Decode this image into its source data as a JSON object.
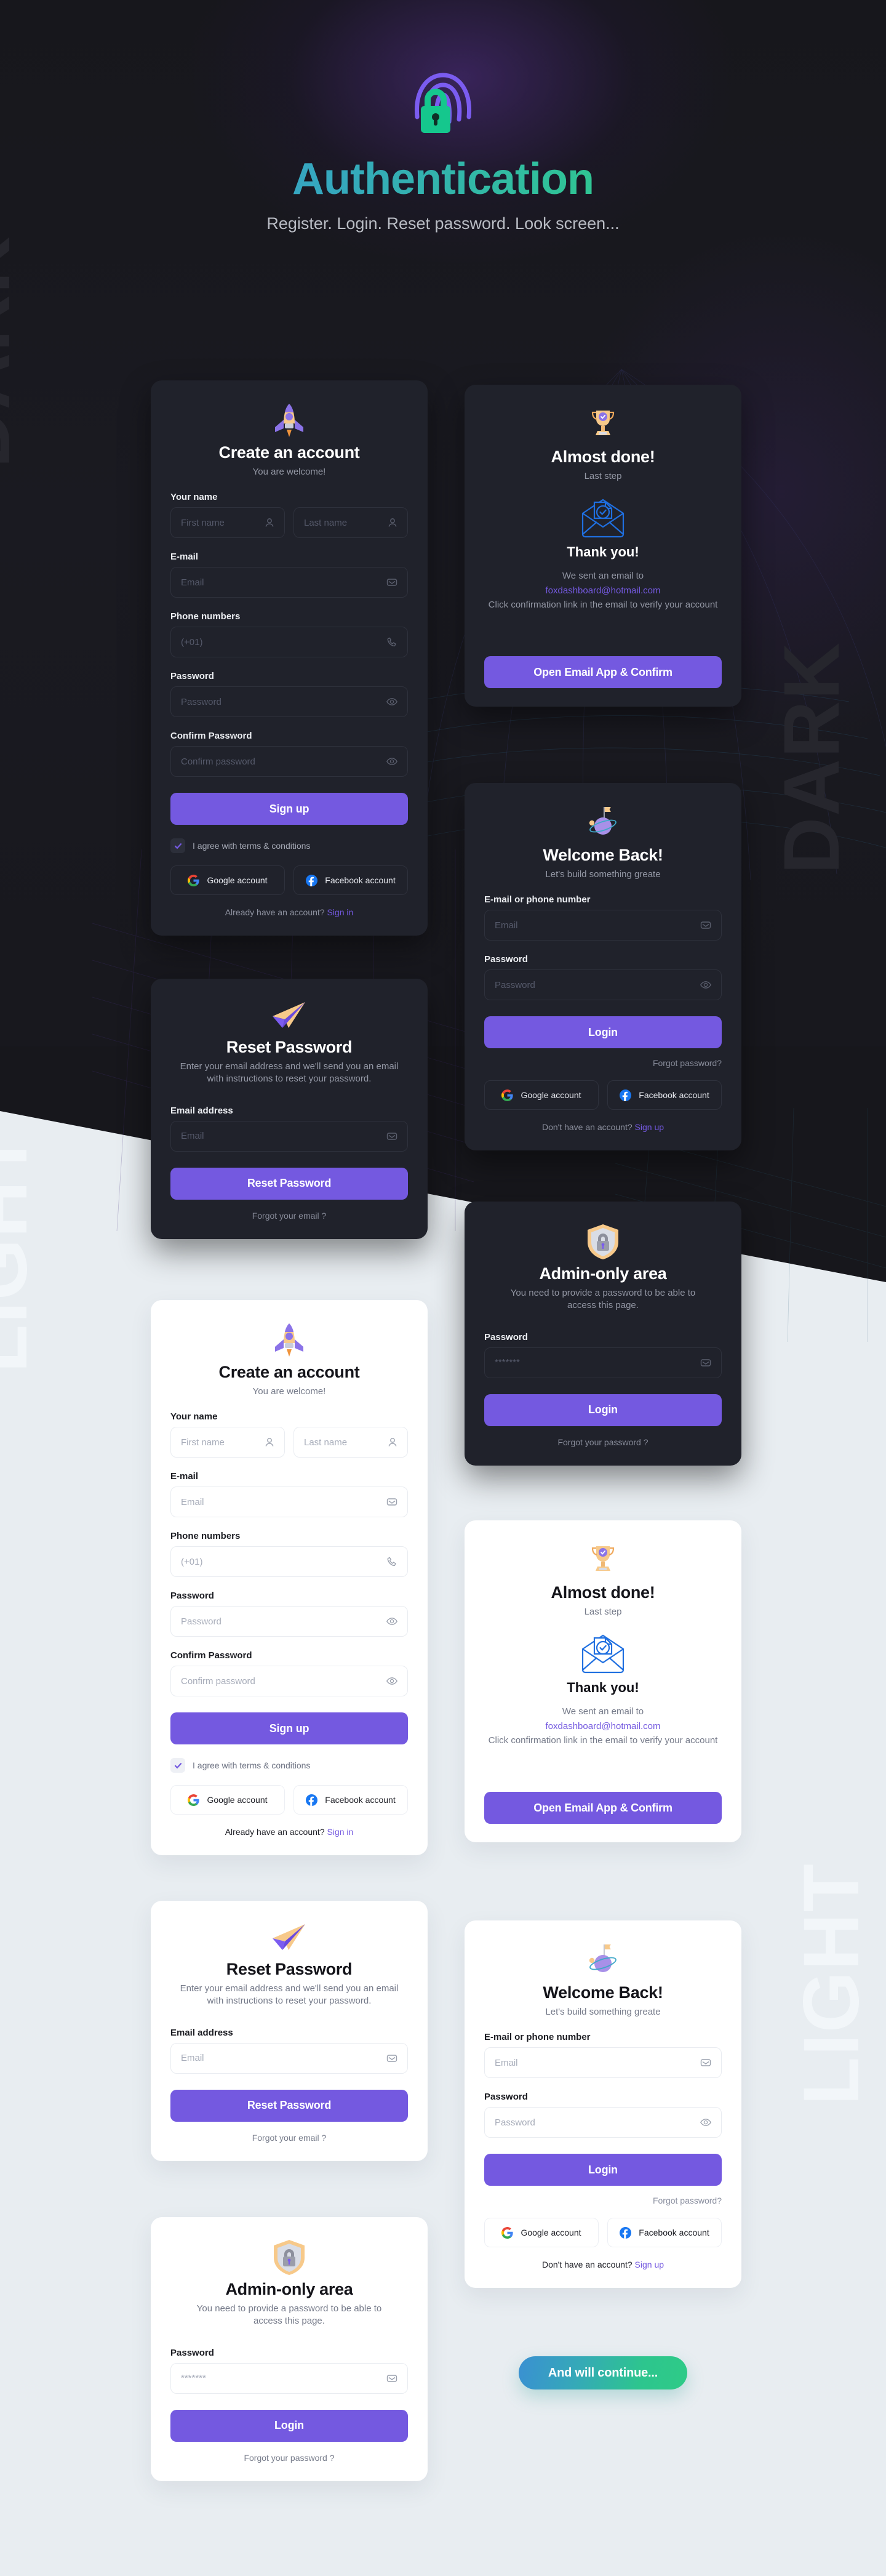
{
  "hero": {
    "title": "Authentication",
    "subtitle": "Register. Login. Reset password. Look screen...",
    "logo_icon": "fingerprint-lock-icon"
  },
  "watermarks": {
    "dark_left": "DARK",
    "dark_right": "DARK",
    "light_left": "LIGHT",
    "light_right": "LIGHT"
  },
  "colors": {
    "accent_purple": "#7459e0",
    "dark_bg": "#17171c",
    "dark_card": "#20222b",
    "light_bg": "#e8edf1",
    "light_card": "#ffffff",
    "gradient_start": "#3a90d2",
    "gradient_end": "#2ecb87",
    "link_purple": "#7459e0"
  },
  "signup": {
    "illustration": "rocket-icon",
    "title": "Create an account",
    "subtitle": "You are welcome!",
    "name_label": "Your name",
    "first_name_placeholder": "First name",
    "last_name_placeholder": "Last name",
    "email_label": "E-mail",
    "email_placeholder": "Email",
    "phone_label": "Phone numbers",
    "phone_placeholder": "(+01)",
    "password_label": "Password",
    "password_placeholder": "Password",
    "confirm_label": "Confirm Password",
    "confirm_placeholder": "Confirm password",
    "submit_label": "Sign up",
    "agree_label": "I agree with terms & conditions",
    "google_label": "Google account",
    "facebook_label": "Facebook account",
    "footnote_text": "Already have an account? ",
    "footnote_link": "Sign in"
  },
  "almost_done": {
    "illustration": "trophy-icon",
    "title": "Almost done!",
    "subtitle": "Last step",
    "mail_icon": "envelope-check-icon",
    "thanks_title": "Thank you!",
    "body_line1": "We sent an email to",
    "email": "foxdashboard@hotmail.com",
    "body_line2": "Click confirmation link in the email to",
    "body_line3": "verify your account",
    "button_label": "Open Email App & Confirm"
  },
  "login": {
    "illustration": "planet-flag-icon",
    "title": "Welcome Back!",
    "subtitle": "Let's build something greate",
    "email_label": "E-mail or phone number",
    "email_placeholder": "Email",
    "password_label": "Password",
    "password_placeholder": "Password",
    "submit_label": "Login",
    "forgot_label": "Forgot password?",
    "google_label": "Google account",
    "facebook_label": "Facebook account",
    "footnote_text": "Don't have an account? ",
    "footnote_link": "Sign up"
  },
  "reset": {
    "illustration": "paper-plane-icon",
    "title": "Reset Password",
    "subtitle": "Enter your email address and we'll send you an email with instructions to reset your password.",
    "email_label": "Email address",
    "email_placeholder": "Email",
    "submit_label": "Reset Password",
    "link_label": "Forgot your email ?"
  },
  "admin": {
    "illustration": "shield-lock-icon",
    "title": "Admin-only area",
    "subtitle": "You need to provide a password to be able to access this page.",
    "password_label": "Password",
    "password_value": "*******",
    "submit_label": "Login",
    "link_label": "Forgot your password ?"
  },
  "continue_button": {
    "label": "And will continue..."
  }
}
